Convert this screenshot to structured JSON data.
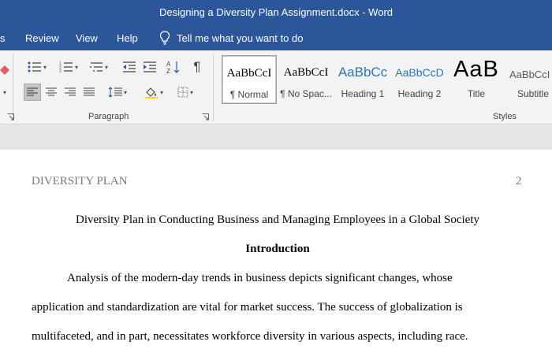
{
  "window": {
    "title": "Designing a Diversity Plan Assignment.docx  -  Word"
  },
  "menu": {
    "tabs": [
      "s",
      "Review",
      "View",
      "Help"
    ],
    "tell_me": "Tell me what you want to do"
  },
  "ribbon": {
    "paragraph_label": "Paragraph",
    "styles_label": "Styles",
    "styles": [
      {
        "sample": "AaBbCcI",
        "name": "¶ Normal"
      },
      {
        "sample": "AaBbCcI",
        "name": "¶ No Spac..."
      },
      {
        "sample": "AaBbCc",
        "name": "Heading 1"
      },
      {
        "sample": "AaBbCcD",
        "name": "Heading 2"
      },
      {
        "sample": "AaB",
        "name": "Title"
      },
      {
        "sample": "AaBbCcI",
        "name": "Subtitle"
      }
    ],
    "style_colors": {
      "heading": "#2e74b5",
      "heading2": "#2e74b5",
      "selected_tile": "#c5c5c5"
    }
  },
  "document": {
    "header_left": "DIVERSITY PLAN",
    "page_number": "2",
    "title": "Diversity Plan in Conducting Business and Managing Employees in a Global Society",
    "heading": "Introduction",
    "paragraph_lines": [
      "Analysis of the modern-day trends in business depicts significant changes, whose",
      "application and standardization are vital for market success. The success of globalization is",
      "multifaceted, and in part, necessitates workforce diversity in various aspects, including race."
    ]
  },
  "colors": {
    "title_bar": "#2b579a",
    "ribbon_bg": "#f3f3f3",
    "band": "#e6e6e6"
  }
}
